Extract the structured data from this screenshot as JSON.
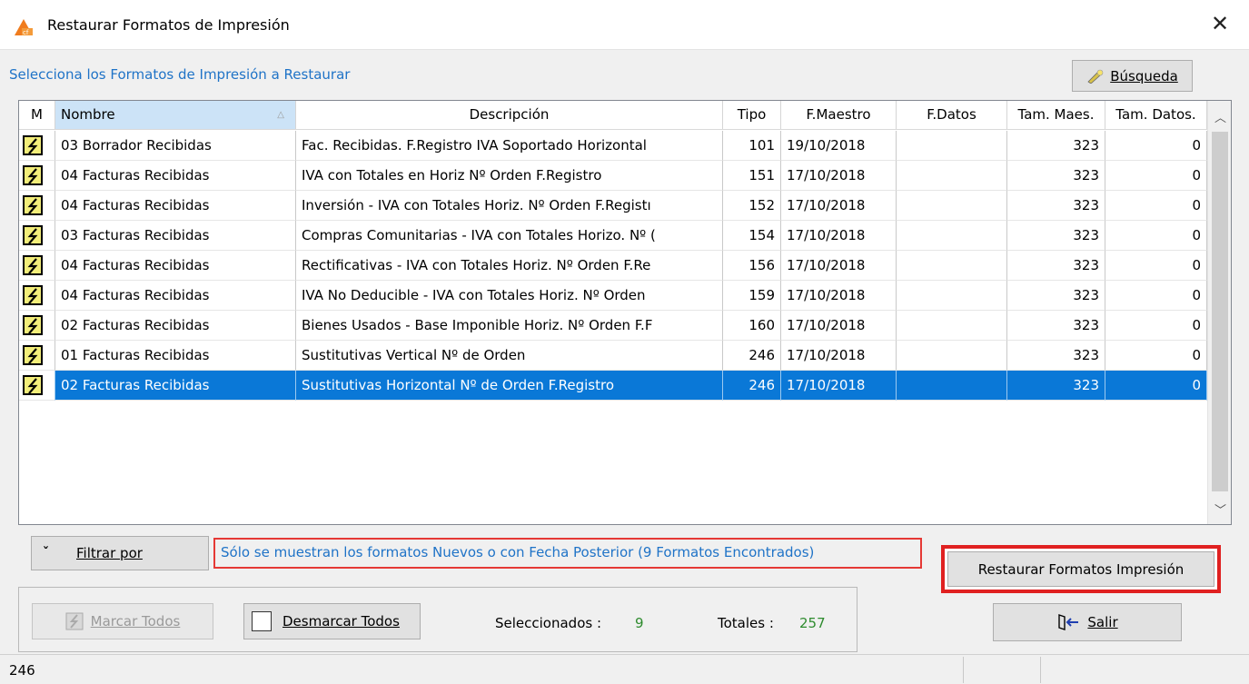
{
  "window": {
    "title": "Restaurar Formatos de Impresión",
    "close_glyph": "✕"
  },
  "subtitle": "Selecciona los Formatos de Impresión a Restaurar",
  "buttons": {
    "busqueda": "Búsqueda",
    "filtrar": "Filtrar por",
    "restaurar": "Restaurar Formatos Impresión",
    "marcar_todos": "Marcar Todos",
    "desmarcar_todos": "Desmarcar Todos",
    "salir": "Salir"
  },
  "filter_info": "Sólo se muestran los formatos Nuevos o con Fecha Posterior (9 Formatos Encontrados)",
  "table": {
    "headers": [
      "M",
      "Nombre",
      "Descripción",
      "Tipo",
      "F.Maestro",
      "F.Datos",
      "Tam. Maes.",
      "Tam. Datos."
    ],
    "sort_glyph": "△",
    "rows": [
      {
        "nombre": "03 Borrador Recibidas",
        "descripcion": "Fac. Recibidas. F.Registro IVA Soportado Horizontal",
        "tipo": "101",
        "f_maestro": "19/10/2018",
        "f_datos": "",
        "tam_maes": "323",
        "tam_datos": "0",
        "selected": false
      },
      {
        "nombre": "04 Facturas Recibidas",
        "descripcion": "IVA con Totales en Horiz Nº Orden F.Registro",
        "tipo": "151",
        "f_maestro": "17/10/2018",
        "f_datos": "",
        "tam_maes": "323",
        "tam_datos": "0",
        "selected": false
      },
      {
        "nombre": "04 Facturas Recibidas",
        "descripcion": "Inversión - IVA con Totales Horiz. Nº Orden F.Registı",
        "tipo": "152",
        "f_maestro": "17/10/2018",
        "f_datos": "",
        "tam_maes": "323",
        "tam_datos": "0",
        "selected": false
      },
      {
        "nombre": "03 Facturas Recibidas",
        "descripcion": "Compras Comunitarias - IVA con Totales Horizo. Nº (",
        "tipo": "154",
        "f_maestro": "17/10/2018",
        "f_datos": "",
        "tam_maes": "323",
        "tam_datos": "0",
        "selected": false
      },
      {
        "nombre": "04 Facturas Recibidas",
        "descripcion": "Rectificativas - IVA con Totales Horiz. Nº Orden F.Re",
        "tipo": "156",
        "f_maestro": "17/10/2018",
        "f_datos": "",
        "tam_maes": "323",
        "tam_datos": "0",
        "selected": false
      },
      {
        "nombre": "04 Facturas Recibidas",
        "descripcion": "IVA No Deducible - IVA con Totales Horiz. Nº Orden",
        "tipo": "159",
        "f_maestro": "17/10/2018",
        "f_datos": "",
        "tam_maes": "323",
        "tam_datos": "0",
        "selected": false
      },
      {
        "nombre": "02 Facturas Recibidas",
        "descripcion": "Bienes Usados - Base Imponible Horiz. Nº Orden F.F",
        "tipo": "160",
        "f_maestro": "17/10/2018",
        "f_datos": "",
        "tam_maes": "323",
        "tam_datos": "0",
        "selected": false
      },
      {
        "nombre": "01 Facturas Recibidas",
        "descripcion": "Sustitutivas Vertical Nº de Orden",
        "tipo": "246",
        "f_maestro": "17/10/2018",
        "f_datos": "",
        "tam_maes": "323",
        "tam_datos": "0",
        "selected": false
      },
      {
        "nombre": "02 Facturas Recibidas",
        "descripcion": "Sustitutivas Horizontal Nº de Orden F.Registro",
        "tipo": "246",
        "f_maestro": "17/10/2018",
        "f_datos": "",
        "tam_maes": "323",
        "tam_datos": "0",
        "selected": true
      }
    ]
  },
  "stats": {
    "seleccionados_label": "Seleccionados :",
    "seleccionados_value": "9",
    "totales_label": "Totales :",
    "totales_value": "257"
  },
  "statusbar": {
    "text": "246"
  },
  "icons": {
    "app": "app-logo-icon",
    "mark": "lightning-check-icon",
    "search": "search-wand-icon",
    "exit": "exit-door-icon",
    "filter": "double-chevron-down-icon"
  },
  "colors": {
    "accent_blue": "#1f73c7",
    "selection": "#0a78d7",
    "highlight_red": "#e02020",
    "stat_green": "#2e8b2e"
  }
}
